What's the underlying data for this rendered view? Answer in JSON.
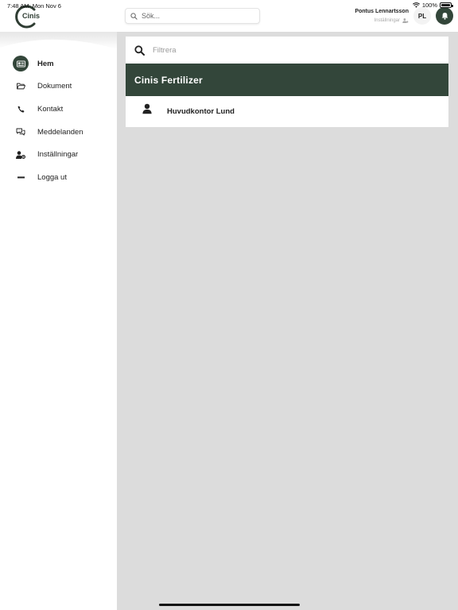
{
  "status_bar": {
    "time": "7:48 AM",
    "date": "Mon Nov 6",
    "battery": "100%"
  },
  "header": {
    "logo_text": "Cinis",
    "search_placeholder": "Sök...",
    "user_name": "Pontus Lennartsson",
    "user_settings_label": "Inställningar",
    "avatar_initials": "PL"
  },
  "sidebar": {
    "items": [
      {
        "label": "Hem",
        "icon": "id-card-icon",
        "active": true
      },
      {
        "label": "Dokument",
        "icon": "folder-open-icon",
        "active": false
      },
      {
        "label": "Kontakt",
        "icon": "phone-icon",
        "active": false
      },
      {
        "label": "Meddelanden",
        "icon": "chat-bubbles-icon",
        "active": false
      },
      {
        "label": "Inställningar",
        "icon": "user-gear-icon",
        "active": false
      },
      {
        "label": "Logga ut",
        "icon": "minus-icon",
        "active": false
      }
    ]
  },
  "main": {
    "filter_placeholder": "Filtrera",
    "company_name": "Cinis Fertilizer",
    "offices": [
      {
        "name": "Huvudkontor Lund",
        "icon": "person-icon"
      }
    ]
  },
  "colors": {
    "brand_dark_green": "#33463a",
    "main_background": "#dcdcdc"
  }
}
